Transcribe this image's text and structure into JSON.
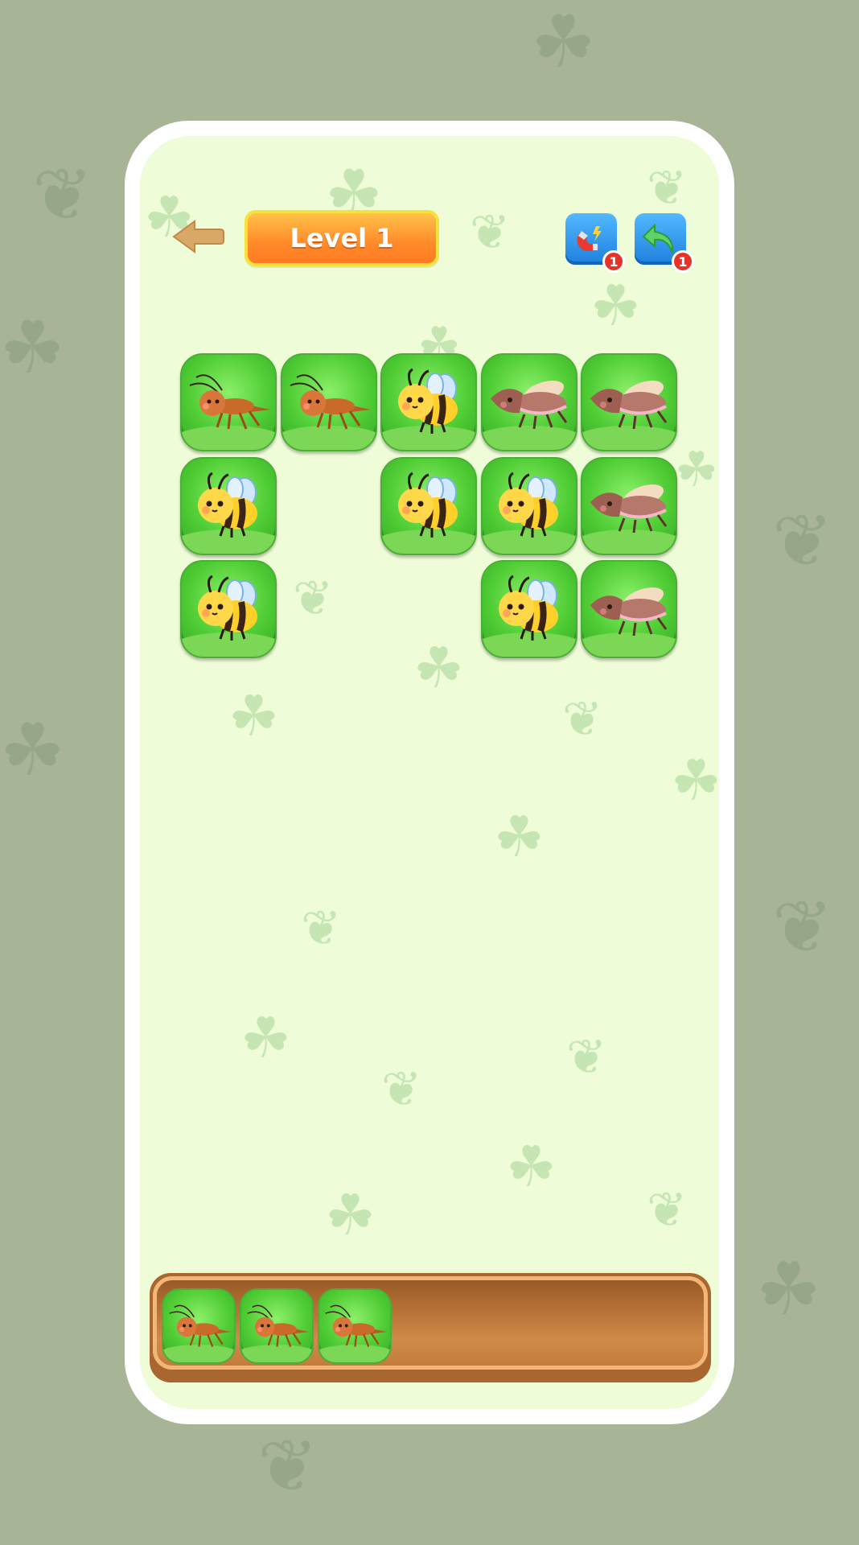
{
  "header": {
    "back_icon": "back-arrow-icon",
    "level_label": "Level 1"
  },
  "powerups": [
    {
      "name": "magnet",
      "icon": "magnet-icon",
      "count": "1"
    },
    {
      "name": "undo",
      "icon": "undo-arrow-icon",
      "count": "1"
    }
  ],
  "board": {
    "rows": [
      [
        "cricket",
        "cricket",
        "bee",
        "beetle",
        "beetle"
      ],
      [
        "bee",
        "",
        "bee",
        "bee",
        "beetle"
      ],
      [
        "bee",
        "",
        "",
        "bee",
        "beetle"
      ]
    ]
  },
  "tray": {
    "capacity_visible": 7,
    "tiles": [
      "cricket",
      "cricket",
      "cricket"
    ]
  },
  "colors": {
    "background": "#a7b496",
    "screen": "#eefcd8",
    "tile_green": "#4fcc34",
    "level_orange": "#ff8a2a",
    "powerup_blue": "#1e7fdc",
    "badge_red": "#e6332a",
    "tray_wood": "#a9662e"
  }
}
